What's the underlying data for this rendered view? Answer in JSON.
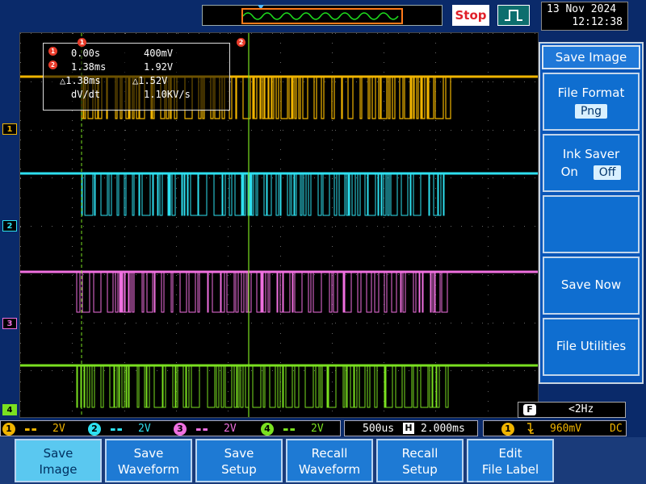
{
  "topbar": {
    "run_state": "Stop",
    "date": "13 Nov 2024",
    "time": "12:12:38",
    "trigger_icon": "pulse-edge-icon"
  },
  "cursors": {
    "row1": {
      "marker": "1",
      "time": "0.00s",
      "volt": "400mV"
    },
    "row2": {
      "marker": "2",
      "time": "1.38ms",
      "volt": "1.92V"
    },
    "row3": {
      "time": "△1.38ms",
      "volt": "△1.52V"
    },
    "row4": {
      "label": "dV/dt",
      "value": "1.10KV/s"
    },
    "top_marker1": "1",
    "top_marker2": "2"
  },
  "channels": [
    {
      "id": "1",
      "color": "#f0b400",
      "scale": "2V"
    },
    {
      "id": "2",
      "color": "#2ee0f0",
      "scale": "2V"
    },
    {
      "id": "3",
      "color": "#f070e0",
      "scale": "2V"
    },
    {
      "id": "4",
      "color": "#7ae020",
      "scale": "2V"
    }
  ],
  "timebase": {
    "scale": "500us",
    "position": "2.000ms",
    "h_icon": "H"
  },
  "trigger": {
    "source": "1",
    "level": "960mV",
    "coupling": "DC",
    "slope_icon": "falling-edge-icon"
  },
  "freq_counter": {
    "icon_letter": "F",
    "value": "<2Hz"
  },
  "right_panel": {
    "title": "Save Image",
    "file_format_label": "File Format",
    "file_format_value": "Png",
    "ink_saver_label": "Ink Saver",
    "ink_on": "On",
    "ink_off": "Off",
    "save_now": "Save Now",
    "file_utilities": "File Utilities"
  },
  "softkeys": [
    {
      "line1": "Save",
      "line2": "Image"
    },
    {
      "line1": "Save",
      "line2": "Waveform"
    },
    {
      "line1": "Save",
      "line2": "Setup"
    },
    {
      "line1": "Recall",
      "line2": "Waveform"
    },
    {
      "line1": "Recall",
      "line2": "Setup"
    },
    {
      "line1": "Edit",
      "line2": "File Label"
    }
  ]
}
